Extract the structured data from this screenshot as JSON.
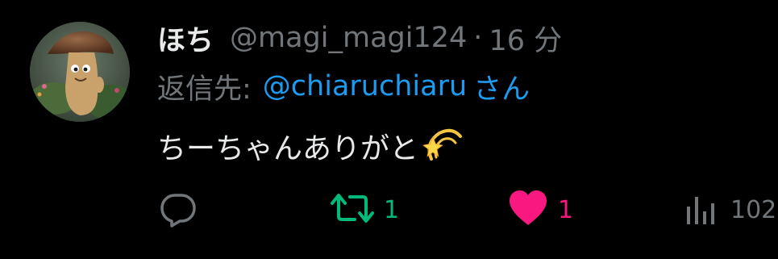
{
  "tweet": {
    "display_name": "ほち",
    "handle": "@magi_magi124",
    "separator": "·",
    "time": "16 分",
    "reply_prefix": "返信先:",
    "reply_to": "@chiaruchiaru",
    "reply_suffix": "さん",
    "text": "ちーちゃんありがと",
    "emoji": "dizzy-emoji"
  },
  "actions": {
    "reply": {
      "icon": "reply-icon",
      "count": ""
    },
    "retweet": {
      "icon": "retweet-icon",
      "count": "1",
      "color": "#00ba7c"
    },
    "like": {
      "icon": "heart-icon",
      "count": "1",
      "color": "#f91880"
    },
    "views": {
      "icon": "views-icon",
      "count": "102"
    }
  },
  "colors": {
    "background": "#000000",
    "primary_text": "#e7e9ea",
    "secondary_text": "#71767b",
    "link": "#1d9bf0"
  }
}
